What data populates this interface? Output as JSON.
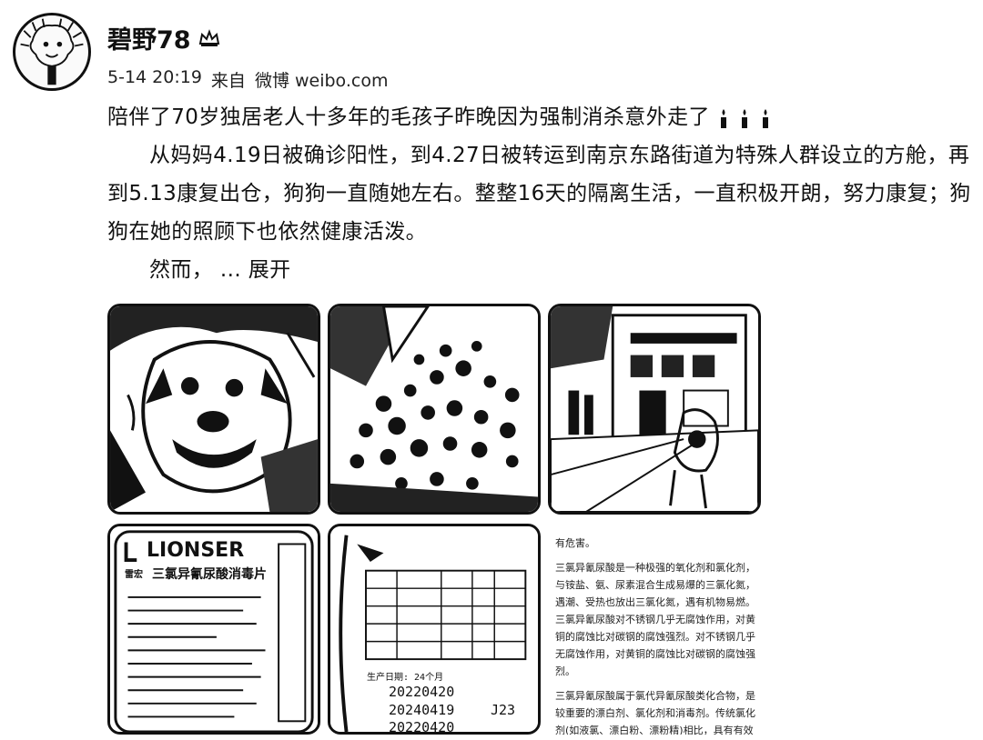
{
  "user": {
    "name": "碧野78",
    "avatar_icon": "avatar-icon",
    "badge_icon": "crown-icon"
  },
  "meta": {
    "time": "5-14 20:19",
    "from_label": "来自",
    "source": "微博 weibo.com"
  },
  "post": {
    "line1": "陪伴了70岁独居老人十多年的毛孩子昨晚因为强制消杀意外走了",
    "paragraph2": "从妈妈4.19日被确诊阳性，到4.27日被转运到南京东路街道为特殊人群设立的方舱，再到5.13康复出仓，狗狗一直随她左右。整整16天的隔离生活，一直积极开朗，努力康复；狗狗在她的照顾下也依然健康活泼。",
    "lead": "然而，",
    "expand_label": "... 展开",
    "emoji_icon": "candle-icon"
  },
  "images": {
    "t4": {
      "brand": "LIONSER",
      "name": "三氯异氰尿酸消毒片",
      "sub": "雷宏"
    },
    "t5": {
      "label_title": "生产日期: 24个月",
      "dates": [
        "20220420",
        "20240419",
        "20220420"
      ],
      "code": "J23"
    },
    "t6": {
      "heading": "有危害。",
      "para1": "三氯异氰尿酸是一种极强的氧化剂和氯化剂，与铵盐、氨、尿素混合生成易爆的三氯化氮，遇潮、受热也放出三氯化氮，遇有机物易燃。三氯异氰尿酸对不锈钢几乎无腐蚀作用，对黄铜的腐蚀比对碳钢的腐蚀强烈。对不锈钢几乎无腐蚀作用，对黄铜的腐蚀比对碳钢的腐蚀强烈。",
      "para2": "三氯异氰尿酸属于氯代异氰尿酸类化合物，是较重要的漂白剂、氯化剂和消毒剂。传统氯化剂(如液氯、漂白粉、漂粉精)相比，具有有效氯含量高、储运稳定、成型和"
    }
  }
}
